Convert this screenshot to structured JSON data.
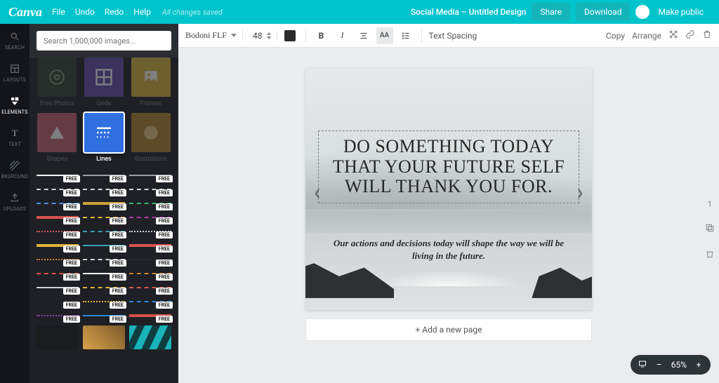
{
  "header": {
    "brand": "Canva",
    "menu": [
      "File",
      "Undo",
      "Redo",
      "Help"
    ],
    "saved_status": "All changes saved",
    "doc_title": "Social Media – Untitled Design",
    "share_label": "Share",
    "download_label": "Download",
    "public_label": "Make public"
  },
  "rail": [
    {
      "label": "SEARCH"
    },
    {
      "label": "LAYOUTS"
    },
    {
      "label": "ELEMENTS"
    },
    {
      "label": "TEXT"
    },
    {
      "label": "BKGROUND"
    },
    {
      "label": "UPLOADS"
    }
  ],
  "rail_active_index": 2,
  "search_placeholder": "Search 1,000,000 images...",
  "categories": [
    {
      "label": "Free Photos",
      "bg": "#3f4a3f"
    },
    {
      "label": "Grids",
      "bg": "#6b56b0"
    },
    {
      "label": "Frames",
      "bg": "#dabb4a"
    },
    {
      "label": "Shapes",
      "bg": "#c76a7a"
    },
    {
      "label": "Lines",
      "bg": "#2f6fe0"
    },
    {
      "label": "Illustrations",
      "bg": "#b68a3d"
    }
  ],
  "categories_selected_index": 4,
  "free_label": "FREE",
  "line_items": [
    {
      "style": "solidln",
      "color": "#ffffff"
    },
    {
      "style": "solidln",
      "color": "#9aa0a6"
    },
    {
      "style": "solidln",
      "color": "#9aa0a6"
    },
    {
      "style": "dashln",
      "color": "#cfd2d6"
    },
    {
      "style": "dashln",
      "color": "#cfd2d6"
    },
    {
      "style": "dashln",
      "color": "#cfd2d6"
    },
    {
      "style": "dashln",
      "color": "#4a90e2"
    },
    {
      "style": "dblln",
      "color": "#cfa23a"
    },
    {
      "style": "dashln",
      "color": "#34b36a"
    },
    {
      "style": "dblln",
      "color": "#d9534f"
    },
    {
      "style": "dashln",
      "color": "#e2b23a"
    },
    {
      "style": "dashln",
      "color": "#b03aa0"
    },
    {
      "style": "dotln",
      "color": "#d9534f"
    },
    {
      "style": "dashln",
      "color": "#3aa0b0"
    },
    {
      "style": "dotln",
      "color": "#cfd2d6"
    },
    {
      "style": "dblln",
      "color": "#e2b23a"
    },
    {
      "style": "solidln",
      "color": "#3aa0b0"
    },
    {
      "style": "dblln",
      "color": "#d9534f"
    },
    {
      "style": "dotln",
      "color": "#d27a2b"
    },
    {
      "style": "dashln",
      "color": "#cfd2d6"
    },
    {
      "style": "dotln",
      "color": "#2a2d30"
    },
    {
      "style": "dashln",
      "color": "#d9534f"
    },
    {
      "style": "solidln",
      "color": "#ffffff"
    },
    {
      "style": "dashln",
      "color": "#d27a2b"
    },
    {
      "style": "solidln",
      "color": "#cfd2d6"
    },
    {
      "style": "dashln",
      "color": "#e2b23a"
    },
    {
      "style": "dashln",
      "color": "#d9534f"
    },
    {
      "style": "waveln",
      "color": "#4a90e2"
    },
    {
      "style": "dotln",
      "color": "#e2b23a"
    },
    {
      "style": "dashln",
      "color": "#2e86d9"
    },
    {
      "style": "dotln",
      "color": "#9a3ab0"
    },
    {
      "style": "solidln",
      "color": "#2e86d9"
    },
    {
      "style": "dblln",
      "color": "#d9534f"
    }
  ],
  "toolbar": {
    "font_name": "Bodoni FLF",
    "font_size": "48",
    "text_spacing_label": "Text Spacing",
    "copy_label": "Copy",
    "arrange_label": "Arrange"
  },
  "design": {
    "main_text": "DO SOMETHING TODAY THAT YOUR FUTURE SELF WILL THANK YOU FOR.",
    "sub_text": "Our actions and decisions today will shape the way we will be living in the future."
  },
  "add_page_label": "+ Add a new page",
  "page_indicator": "1",
  "zoom": {
    "value": "65%"
  }
}
